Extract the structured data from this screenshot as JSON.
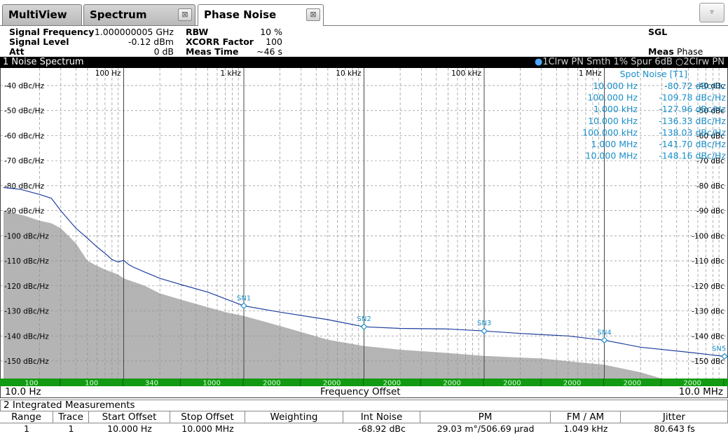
{
  "tabs": [
    {
      "label": "MultiView",
      "active": false
    },
    {
      "label": "Spectrum",
      "active": false
    },
    {
      "label": "Phase Noise",
      "active": true
    }
  ],
  "tab_close_glyph": "⊠",
  "dropdown_glyph": "▿",
  "header": {
    "signal_frequency_label": "Signal Frequency",
    "signal_frequency_value": "1.000000005 GHz",
    "signal_level_label": "Signal Level",
    "signal_level_value": "-0.12 dBm",
    "att_label": "Att",
    "att_value": "0 dB",
    "rbw_label": "RBW",
    "rbw_value": "10 %",
    "xcorr_label": "XCORR Factor",
    "xcorr_value": "100",
    "meas_time_label": "Meas Time",
    "meas_time_value": "~46 s",
    "sgl": "SGL",
    "meas_label": "Meas",
    "meas_value": "Phase Noise"
  },
  "diagram": {
    "title": "1 Noise Spectrum",
    "trace1": "1Clrw PN Smth 1% Spur 6dB",
    "trace2": "2Clrw PN",
    "start_freq": "10.0 Hz",
    "stop_freq": "10.0 MHz",
    "x_axis_label": "Frequency Offset"
  },
  "colors": {
    "trace_blue": "#1f3f9f",
    "marker_blue": "#1a8fc8",
    "floor_gray": "#b4b4b4",
    "rbw_green": "#139a13",
    "grid": "#909090"
  },
  "chart_data": {
    "type": "line",
    "x_scale": "log",
    "xlim": [
      10,
      10000000
    ],
    "ylim": [
      -157,
      -33
    ],
    "x_ticks": [
      {
        "value": 100,
        "label": "100 Hz"
      },
      {
        "value": 1000,
        "label": "1 kHz"
      },
      {
        "value": 10000,
        "label": "10 kHz"
      },
      {
        "value": 100000,
        "label": "100 kHz"
      },
      {
        "value": 1000000,
        "label": "1 MHz"
      }
    ],
    "y_ticks_left": [
      {
        "value": -40,
        "label": "-40 dBc/Hz"
      },
      {
        "value": -50,
        "label": "-50 dBc/Hz"
      },
      {
        "value": -60,
        "label": "-60 dBc/Hz"
      },
      {
        "value": -70,
        "label": "-70 dBc/Hz"
      },
      {
        "value": -80,
        "label": "-80 dBc/Hz"
      },
      {
        "value": -90,
        "label": "-90 dBc/Hz"
      },
      {
        "value": -100,
        "label": "-100 dBc/Hz"
      },
      {
        "value": -110,
        "label": "-110 dBc/Hz"
      },
      {
        "value": -120,
        "label": "-120 dBc/Hz"
      },
      {
        "value": -130,
        "label": "-130 dBc/Hz"
      },
      {
        "value": -140,
        "label": "-140 dBc/Hz"
      },
      {
        "value": -150,
        "label": "-150 dBc/Hz"
      }
    ],
    "y_ticks_right": [
      {
        "value": -40,
        "label": "-40 dBc"
      },
      {
        "value": -50,
        "label": "-50 dBc"
      },
      {
        "value": -60,
        "label": "-60 dBc"
      },
      {
        "value": -70,
        "label": "-70 dBc"
      },
      {
        "value": -80,
        "label": "-80 dBc"
      },
      {
        "value": -90,
        "label": "-90 dBc"
      },
      {
        "value": -100,
        "label": "-100 dBc"
      },
      {
        "value": -110,
        "label": "-110 dBc"
      },
      {
        "value": -120,
        "label": "-120 dBc"
      },
      {
        "value": -130,
        "label": "-130 dBc"
      },
      {
        "value": -140,
        "label": "-140 dBc"
      },
      {
        "value": -150,
        "label": "-150 dBc"
      }
    ],
    "grid": true,
    "series": [
      {
        "key": "trace1",
        "x": [
          10,
          14,
          20,
          25,
          30,
          40,
          50,
          60,
          70,
          80,
          90,
          100,
          110,
          120,
          150,
          200,
          300,
          500,
          1000,
          2000,
          5000,
          10000,
          20000,
          50000,
          100000,
          200000,
          500000,
          1000000,
          2000000,
          5000000,
          10000000
        ],
        "y": [
          -80.72,
          -81.5,
          -83.5,
          -85,
          -90,
          -97,
          -101,
          -104.5,
          -107,
          -109.5,
          -110.5,
          -109.78,
          -111.5,
          -112.5,
          -114.5,
          -117,
          -119.5,
          -122.5,
          -127.96,
          -130.5,
          -133.5,
          -136.33,
          -137,
          -137.2,
          -138.03,
          -139,
          -140,
          -141.7,
          -144.5,
          -146.5,
          -148.16
        ]
      },
      {
        "key": "trace2",
        "x": [
          10,
          15,
          20,
          25,
          30,
          40,
          50,
          60,
          70,
          80,
          90,
          100,
          150,
          200,
          300,
          500,
          700,
          1000,
          2000,
          5000,
          10000,
          20000,
          50000,
          100000,
          300000,
          600000,
          1000000,
          2000000,
          3000000
        ],
        "y": [
          -90,
          -92,
          -94,
          -95,
          -97,
          -103,
          -110,
          -112,
          -113.5,
          -114.5,
          -115.5,
          -117,
          -120,
          -123,
          -125.5,
          -128.5,
          -130.5,
          -132,
          -136,
          -141.5,
          -144,
          -145.5,
          -146.8,
          -148,
          -149,
          -150.5,
          -151.5,
          -154.5,
          -157
        ]
      }
    ],
    "spot_markers": [
      {
        "label": "SN1",
        "x": 1000,
        "y": -127.96
      },
      {
        "label": "SN2",
        "x": 10000,
        "y": -136.33
      },
      {
        "label": "SN3",
        "x": 100000,
        "y": -138.03
      },
      {
        "label": "SN4",
        "x": 1000000,
        "y": -141.7
      },
      {
        "label": "SN5",
        "x": 10000000,
        "y": -148.16
      }
    ],
    "spot_noise_table": {
      "title": "Spot Noise [T1]",
      "rows": [
        {
          "freq": "10.000 Hz",
          "value": "-80.72 dBc/Hz"
        },
        {
          "freq": "100.000 Hz",
          "value": "-109.78 dBc/Hz"
        },
        {
          "freq": "1.000 kHz",
          "value": "-127.96 dBc/Hz"
        },
        {
          "freq": "10.000 kHz",
          "value": "-136.33 dBc/Hz"
        },
        {
          "freq": "100.000 kHz",
          "value": "-138.03 dBc/Hz"
        },
        {
          "freq": "1.000 MHz",
          "value": "-141.70 dBc/Hz"
        },
        {
          "freq": "10.000 MHz",
          "value": "-148.16 dBc/Hz"
        }
      ]
    },
    "rbw_segments": [
      {
        "from": 10,
        "to": 30,
        "label": "100"
      },
      {
        "from": 30,
        "to": 100,
        "label": "100"
      },
      {
        "from": 100,
        "to": 300,
        "label": "340"
      },
      {
        "from": 300,
        "to": 1000,
        "label": "1000"
      },
      {
        "from": 1000,
        "to": 3000,
        "label": "2000"
      },
      {
        "from": 3000,
        "to": 10000,
        "label": "2000"
      },
      {
        "from": 10000,
        "to": 30000,
        "label": "2000"
      },
      {
        "from": 30000,
        "to": 100000,
        "label": "2000"
      },
      {
        "from": 100000,
        "to": 300000,
        "label": "2000"
      },
      {
        "from": 300000,
        "to": 1000000,
        "label": "2000"
      },
      {
        "from": 1000000,
        "to": 3000000,
        "label": "2000"
      },
      {
        "from": 3000000,
        "to": 10000000,
        "label": "2000"
      }
    ]
  },
  "integrated": {
    "title": "2 Integrated Measurements",
    "headers": [
      "Range",
      "Trace",
      "Start Offset",
      "Stop Offset",
      "Weighting",
      "Int Noise",
      "PM",
      "FM / AM",
      "Jitter"
    ],
    "row": [
      "1",
      "1",
      "10.000 Hz",
      "10.000 MHz",
      "",
      "-68.92 dBc",
      "29.03 m°/506.69 µrad",
      "1.049 kHz",
      "80.643 fs"
    ]
  }
}
